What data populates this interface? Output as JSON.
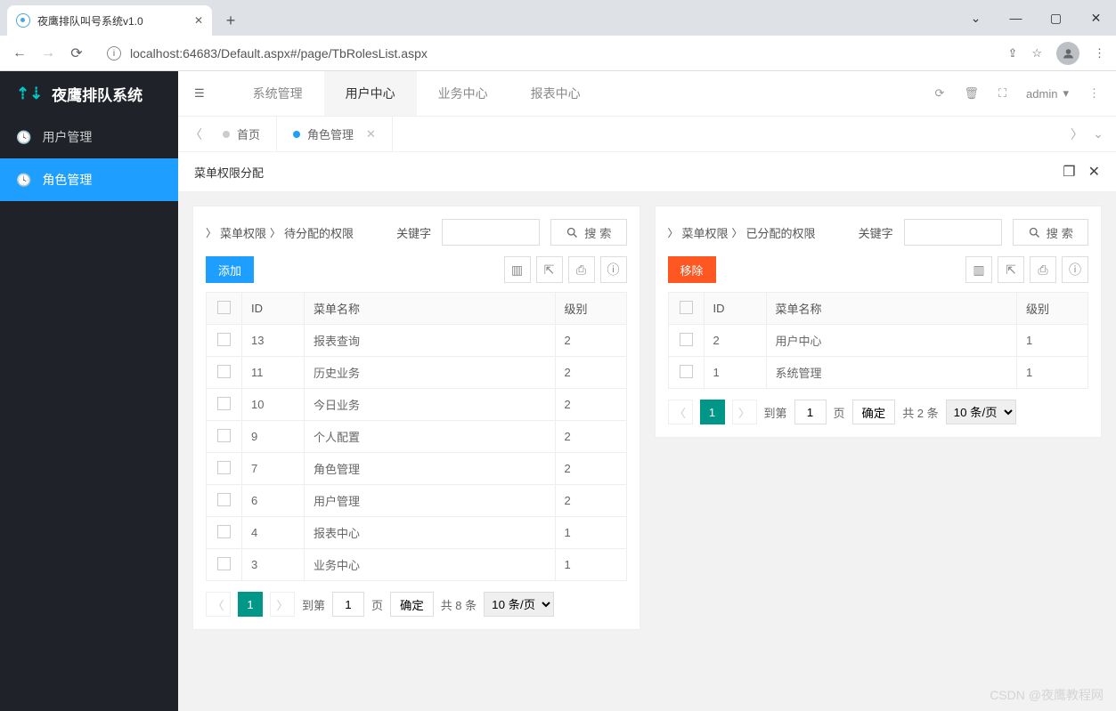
{
  "browser": {
    "tab_title": "夜鹰排队叫号系统v1.0",
    "url": "localhost:64683/Default.aspx#/page/TbRolesList.aspx"
  },
  "app": {
    "brand": "夜鹰排队系统",
    "sidebar": [
      {
        "label": "用户管理",
        "active": false
      },
      {
        "label": "角色管理",
        "active": true
      }
    ],
    "topnav": [
      {
        "label": "系统管理",
        "active": false
      },
      {
        "label": "用户中心",
        "active": true
      },
      {
        "label": "业务中心",
        "active": false
      },
      {
        "label": "报表中心",
        "active": false
      }
    ],
    "user": "admin",
    "page_tabs": {
      "home": "首页",
      "active": "角色管理"
    },
    "page_title": "菜单权限分配"
  },
  "left": {
    "bc1": "菜单权限",
    "bc2": "待分配的权限",
    "kw_label": "关键字",
    "kw_value": "",
    "search_label": "搜 索",
    "add_label": "添加",
    "columns": {
      "id": "ID",
      "name": "菜单名称",
      "level": "级别"
    },
    "rows": [
      {
        "id": "13",
        "name": "报表查询",
        "level": "2"
      },
      {
        "id": "11",
        "name": "历史业务",
        "level": "2"
      },
      {
        "id": "10",
        "name": "今日业务",
        "level": "2"
      },
      {
        "id": "9",
        "name": "个人配置",
        "level": "2"
      },
      {
        "id": "7",
        "name": "角色管理",
        "level": "2"
      },
      {
        "id": "6",
        "name": "用户管理",
        "level": "2"
      },
      {
        "id": "4",
        "name": "报表中心",
        "level": "1"
      },
      {
        "id": "3",
        "name": "业务中心",
        "level": "1"
      }
    ],
    "pager": {
      "current": "1",
      "goto_label": "到第",
      "goto_value": "1",
      "page_label": "页",
      "confirm": "确定",
      "total": "共 8 条",
      "per_page": "10 条/页"
    }
  },
  "right": {
    "bc1": "菜单权限",
    "bc2": "已分配的权限",
    "kw_label": "关键字",
    "kw_value": "",
    "search_label": "搜 索",
    "remove_label": "移除",
    "columns": {
      "id": "ID",
      "name": "菜单名称",
      "level": "级别"
    },
    "rows": [
      {
        "id": "2",
        "name": "用户中心",
        "level": "1"
      },
      {
        "id": "1",
        "name": "系统管理",
        "level": "1"
      }
    ],
    "pager": {
      "current": "1",
      "goto_label": "到第",
      "goto_value": "1",
      "page_label": "页",
      "confirm": "确定",
      "total": "共 2 条",
      "per_page": "10 条/页"
    }
  },
  "watermark": "CSDN @夜鹰教程网"
}
